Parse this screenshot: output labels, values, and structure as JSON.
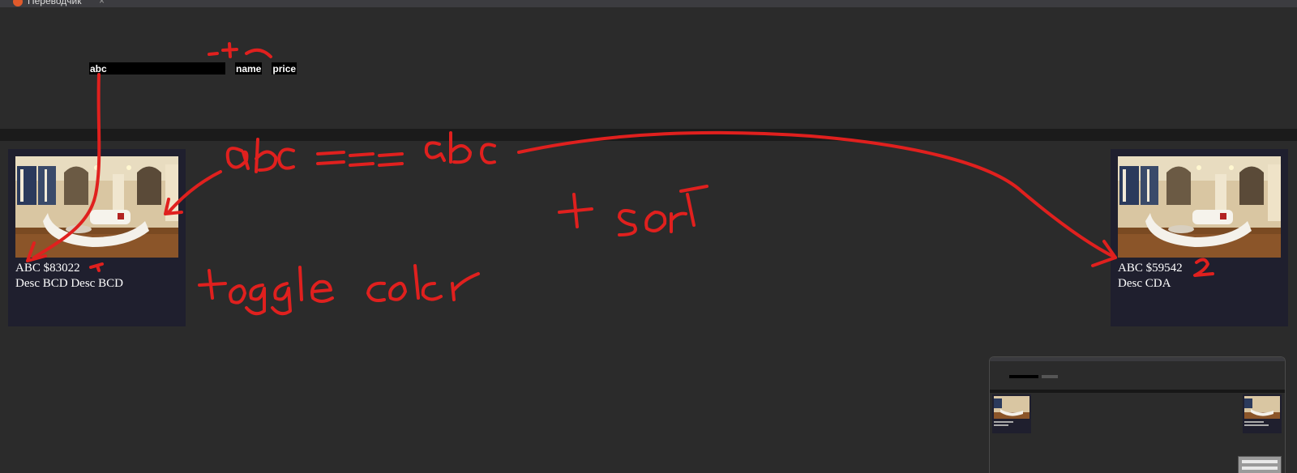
{
  "browser": {
    "tab_title": "Переводчик",
    "tab_close_glyph": "×"
  },
  "search": {
    "value": "abc"
  },
  "sort_buttons": [
    {
      "label": "name"
    },
    {
      "label": "price"
    }
  ],
  "cards": [
    {
      "title": "ABC $83022",
      "description": "Desc BCD Desc BCD",
      "image": "living-room-photo"
    },
    {
      "title": "ABC $59542",
      "description": "Desc CDA",
      "image": "living-room-photo"
    }
  ],
  "annotations": {
    "color": "#e0201e",
    "texts": [
      "abc === abc",
      "+ sort",
      "toggle color",
      "1",
      "2",
      "-+"
    ]
  },
  "colors": {
    "page_background": "#2b2b2b",
    "card_background": "#1f1f2e",
    "divider": "#1b1b1b",
    "annotation": "#e0201e"
  }
}
